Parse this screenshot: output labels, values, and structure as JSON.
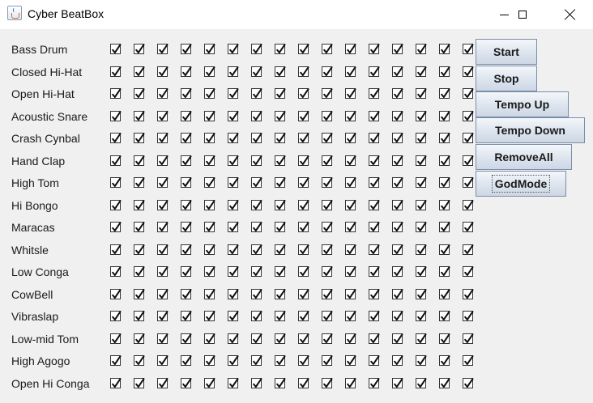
{
  "window": {
    "title": "Cyber BeatBox"
  },
  "instruments": [
    "Bass Drum",
    "Closed Hi-Hat",
    "Open Hi-Hat",
    "Acoustic Snare",
    "Crash Cynbal",
    "Hand Clap",
    "High Tom",
    "Hi Bongo",
    "Maracas",
    "Whitsle",
    "Low Conga",
    "CowBell",
    "Vibraslap",
    "Low-mid Tom",
    "High Agogo",
    "Open Hi Conga"
  ],
  "steps_per_row": 16,
  "grid": [
    [
      true,
      true,
      true,
      true,
      true,
      true,
      true,
      true,
      true,
      true,
      true,
      true,
      true,
      true,
      true,
      true
    ],
    [
      true,
      true,
      true,
      true,
      true,
      true,
      true,
      true,
      true,
      true,
      true,
      true,
      true,
      true,
      true,
      true
    ],
    [
      true,
      true,
      true,
      true,
      true,
      true,
      true,
      true,
      true,
      true,
      true,
      true,
      true,
      true,
      true,
      true
    ],
    [
      true,
      true,
      true,
      true,
      true,
      true,
      true,
      true,
      true,
      true,
      true,
      true,
      true,
      true,
      true,
      true
    ],
    [
      true,
      true,
      true,
      true,
      true,
      true,
      true,
      true,
      true,
      true,
      true,
      true,
      true,
      true,
      true,
      true
    ],
    [
      true,
      true,
      true,
      true,
      true,
      true,
      true,
      true,
      true,
      true,
      true,
      true,
      true,
      true,
      true,
      true
    ],
    [
      true,
      true,
      true,
      true,
      true,
      true,
      true,
      true,
      true,
      true,
      true,
      true,
      true,
      true,
      true,
      true
    ],
    [
      true,
      true,
      true,
      true,
      true,
      true,
      true,
      true,
      true,
      true,
      true,
      true,
      true,
      true,
      true,
      true
    ],
    [
      true,
      true,
      true,
      true,
      true,
      true,
      true,
      true,
      true,
      true,
      true,
      true,
      true,
      true,
      true,
      true
    ],
    [
      true,
      true,
      true,
      true,
      true,
      true,
      true,
      true,
      true,
      true,
      true,
      true,
      true,
      true,
      true,
      true
    ],
    [
      true,
      true,
      true,
      true,
      true,
      true,
      true,
      true,
      true,
      true,
      true,
      true,
      true,
      true,
      true,
      true
    ],
    [
      true,
      true,
      true,
      true,
      true,
      true,
      true,
      true,
      true,
      true,
      true,
      true,
      true,
      true,
      true,
      true
    ],
    [
      true,
      true,
      true,
      true,
      true,
      true,
      true,
      true,
      true,
      true,
      true,
      true,
      true,
      true,
      true,
      true
    ],
    [
      true,
      true,
      true,
      true,
      true,
      true,
      true,
      true,
      true,
      true,
      true,
      true,
      true,
      true,
      true,
      true
    ],
    [
      true,
      true,
      true,
      true,
      true,
      true,
      true,
      true,
      true,
      true,
      true,
      true,
      true,
      true,
      true,
      true
    ],
    [
      true,
      true,
      true,
      true,
      true,
      true,
      true,
      true,
      true,
      true,
      true,
      true,
      true,
      true,
      true,
      true
    ]
  ],
  "buttons": {
    "start": "Start",
    "stop": "Stop",
    "tempo_up": "Tempo Up",
    "tempo_down": "Tempo Down",
    "remove_all": "RemoveAll",
    "god_mode": "GodMode"
  },
  "icons": {
    "app": "java-cup-icon",
    "minimize": "minimize-icon",
    "maximize": "maximize-icon",
    "close": "close-icon"
  }
}
